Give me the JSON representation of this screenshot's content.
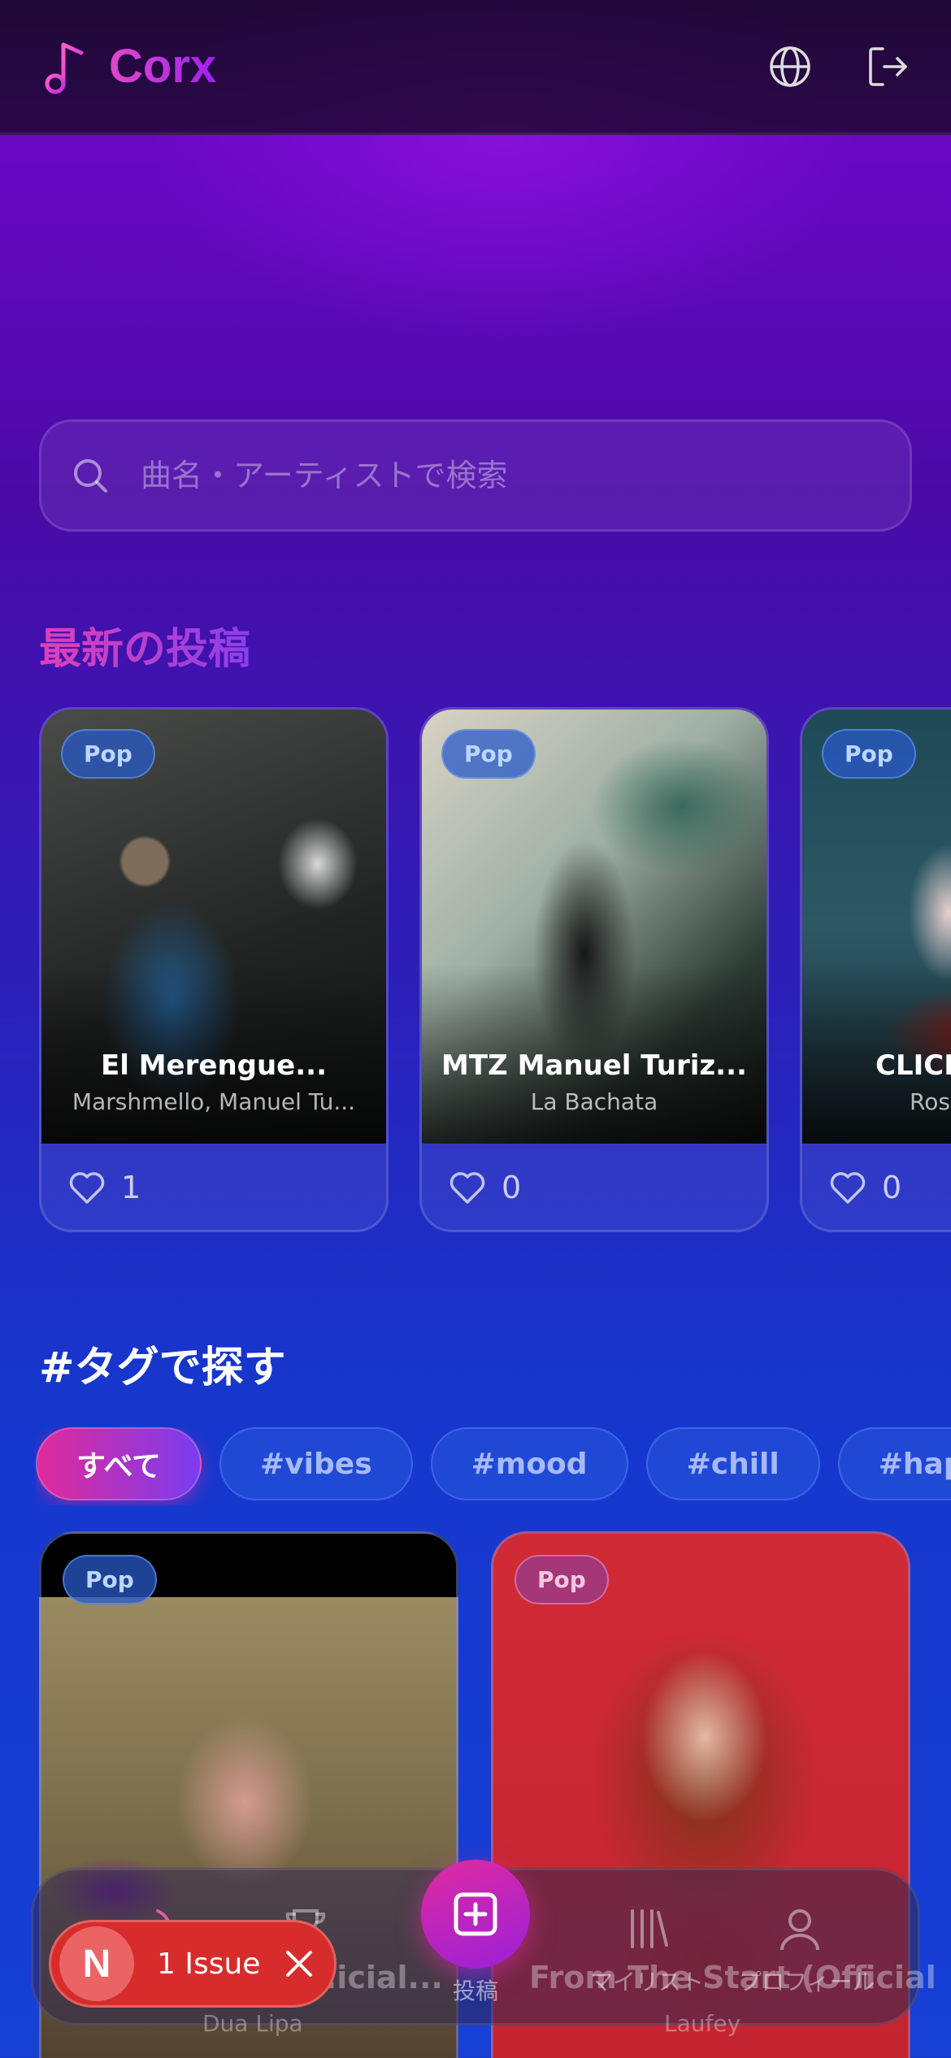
{
  "app": {
    "name": "Corx"
  },
  "header": {
    "language_icon": "globe-icon",
    "logout_icon": "logout-icon"
  },
  "search": {
    "placeholder": "曲名・アーティストで検索"
  },
  "latest": {
    "title": "最新の投稿",
    "cards": [
      {
        "genre": "Pop",
        "title": "El Merengue...",
        "artist": "Marshmello, Manuel Tu...",
        "likes": "1"
      },
      {
        "genre": "Pop",
        "title": "MTZ Manuel Turiz...",
        "artist": "La Bachata",
        "likes": "0"
      },
      {
        "genre": "Pop",
        "title": "CLICK",
        "artist": "Rosé",
        "likes": "0"
      }
    ]
  },
  "tags": {
    "title": "#タグで探す",
    "chips": [
      "すべて",
      "#vibes",
      "#mood",
      "#chill",
      "#happy"
    ]
  },
  "grid": {
    "cards": [
      {
        "genre": "Pop",
        "title": "...icial...",
        "artist": "Dua Lipa"
      },
      {
        "genre": "Pop",
        "title": "From The Start (Official",
        "artist": "Laufey"
      }
    ]
  },
  "nav": {
    "post_label": "投稿",
    "mylist_label": "マイリスト",
    "profile_label": "プロフィール"
  },
  "issue": {
    "avatar_letter": "N",
    "text": "1 Issue"
  }
}
